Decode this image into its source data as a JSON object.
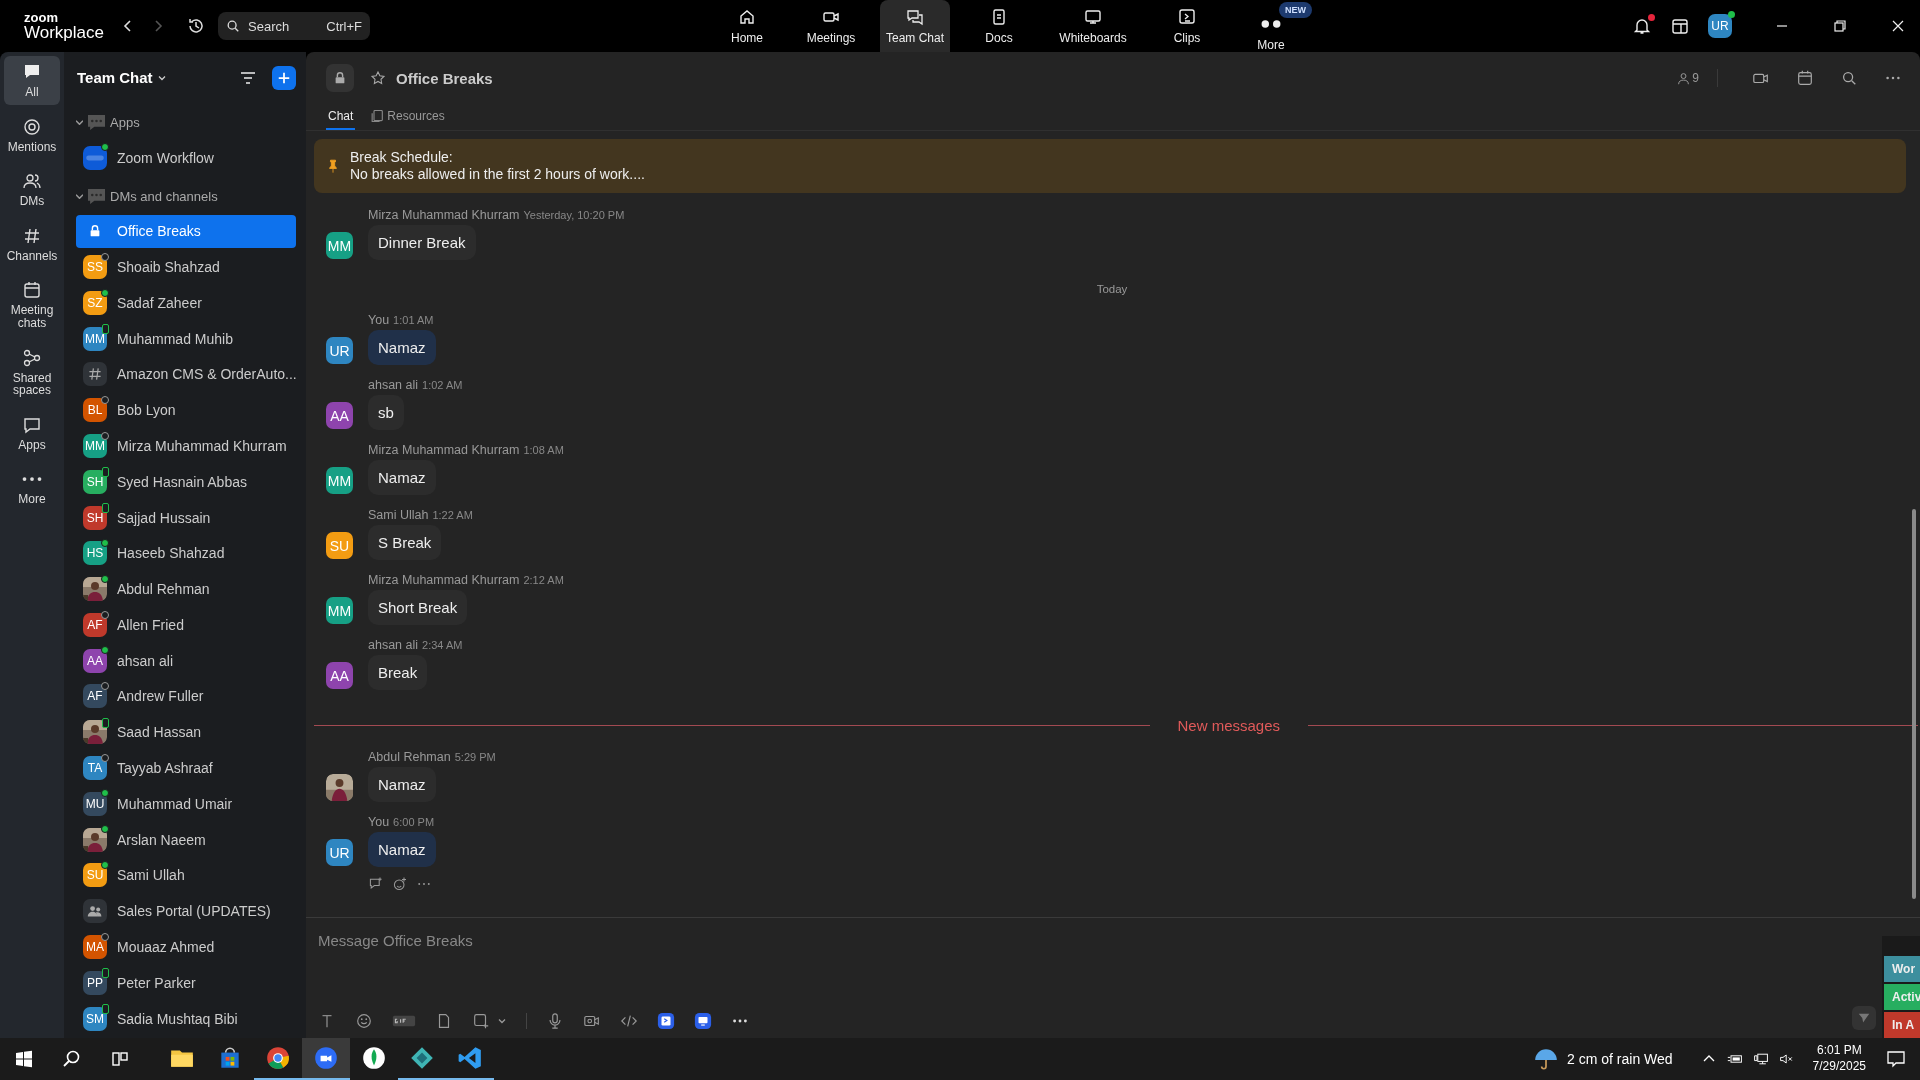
{
  "app": {
    "logo_top": "zoom",
    "logo_bottom": "Workplace"
  },
  "search": {
    "placeholder": "Search",
    "shortcut": "Ctrl+F"
  },
  "nav": [
    {
      "kind": "home",
      "label": "Home",
      "selected": false
    },
    {
      "kind": "meetings",
      "label": "Meetings",
      "selected": false
    },
    {
      "kind": "chat",
      "label": "Team Chat",
      "selected": true
    },
    {
      "kind": "docs",
      "label": "Docs",
      "selected": false
    },
    {
      "kind": "whiteboards",
      "label": "Whiteboards",
      "selected": false
    },
    {
      "kind": "clips",
      "label": "Clips",
      "selected": false
    },
    {
      "kind": "more",
      "label": "More",
      "selected": false,
      "badge": "NEW"
    }
  ],
  "account": {
    "initials": "UR",
    "notification_unread": true
  },
  "rail": [
    {
      "kind": "all",
      "label": "All",
      "selected": true
    },
    {
      "kind": "mentions",
      "label": "Mentions",
      "selected": false
    },
    {
      "kind": "dms",
      "label": "DMs",
      "selected": false
    },
    {
      "kind": "channels",
      "label": "Channels",
      "selected": false
    },
    {
      "kind": "meeting-chats",
      "label": "Meeting chats",
      "selected": false
    },
    {
      "kind": "shared",
      "label": "Shared spaces",
      "selected": false
    },
    {
      "kind": "apps",
      "label": "Apps",
      "selected": false
    },
    {
      "kind": "more",
      "label": "More",
      "selected": false
    }
  ],
  "sidebar": {
    "title": "Team Chat",
    "sections": [
      {
        "label": "Apps",
        "expanded": true,
        "items": [
          {
            "kind": "app",
            "name": "Zoom Workflow",
            "online": true,
            "mobile": false,
            "selected": false
          }
        ]
      },
      {
        "label": "DMs and channels",
        "expanded": true,
        "items": [
          {
            "kind": "channel",
            "name": "Office Breaks",
            "selected": true
          },
          {
            "kind": "dm",
            "name": "Shoaib Shahzad",
            "initials": "SS",
            "color": "#f39c12",
            "online": false,
            "mobile": false,
            "selected": false
          },
          {
            "kind": "dm",
            "name": "Sadaf Zaheer",
            "initials": "SZ",
            "color": "#f39c12",
            "online": true,
            "mobile": false,
            "selected": false
          },
          {
            "kind": "dm",
            "name": "Muhammad Muhib",
            "initials": "MM",
            "color": "#2e86c1",
            "online": true,
            "mobile": true,
            "selected": false
          },
          {
            "kind": "group-channel",
            "name": "Amazon CMS & OrderAuto...",
            "selected": false
          },
          {
            "kind": "dm",
            "name": "Bob Lyon",
            "initials": "BL",
            "color": "#d35400",
            "online": false,
            "mobile": false,
            "selected": false
          },
          {
            "kind": "dm",
            "name": "Mirza Muhammad Khurram",
            "initials": "MM",
            "color": "#16a085",
            "online": false,
            "mobile": false,
            "selected": false
          },
          {
            "kind": "dm",
            "name": "Syed Hasnain Abbas",
            "initials": "SH",
            "color": "#27ae60",
            "online": true,
            "mobile": true,
            "selected": false
          },
          {
            "kind": "dm",
            "name": "Sajjad Hussain",
            "initials": "SH",
            "color": "#c0392b",
            "online": true,
            "mobile": true,
            "selected": false
          },
          {
            "kind": "dm",
            "name": "Haseeb Shahzad",
            "initials": "HS",
            "color": "#16a085",
            "online": true,
            "mobile": false,
            "selected": false
          },
          {
            "name": "Abdul Rehman",
            "online": true,
            "mobile": false,
            "selected": false
          },
          {
            "kind": "dm",
            "name": "Allen Fried",
            "initials": "AF",
            "color": "#c0392b",
            "online": false,
            "mobile": false,
            "selected": false
          },
          {
            "kind": "dm",
            "name": "ahsan ali",
            "initials": "AA",
            "color": "#8e44ad",
            "online": true,
            "mobile": false,
            "selected": false
          },
          {
            "kind": "dm",
            "name": "Andrew Fuller",
            "initials": "AF",
            "color": "#34495e",
            "online": false,
            "mobile": false,
            "selected": false
          },
          {
            "name": "Saad Hassan",
            "online": true,
            "mobile": true,
            "selected": false
          },
          {
            "kind": "dm",
            "name": "Tayyab Ashraaf",
            "initials": "TA",
            "color": "#2e86c1",
            "online": false,
            "mobile": false,
            "selected": false
          },
          {
            "kind": "dm",
            "name": "Muhammad Umair",
            "initials": "MU",
            "color": "#34495e",
            "online": true,
            "mobile": false,
            "selected": false
          },
          {
            "name": "Arslan Naeem",
            "online": true,
            "mobile": false,
            "selected": false
          },
          {
            "kind": "dm",
            "name": "Sami Ullah",
            "initials": "SU",
            "color": "#f39c12",
            "online": true,
            "mobile": false,
            "selected": false
          },
          {
            "kind": "group",
            "name": "Sales Portal (UPDATES)",
            "selected": false
          },
          {
            "kind": "dm",
            "name": "Mouaaz Ahmed",
            "initials": "MA",
            "color": "#d35400",
            "online": false,
            "mobile": false,
            "selected": false
          },
          {
            "kind": "dm",
            "name": "Peter Parker",
            "initials": "PP",
            "color": "#34495e",
            "online": true,
            "mobile": true,
            "selected": false
          },
          {
            "kind": "dm",
            "name": "Sadia Mushtaq Bibi",
            "initials": "SM",
            "color": "#2e86c1",
            "online": true,
            "mobile": true,
            "selected": false
          }
        ]
      }
    ]
  },
  "chat": {
    "title": "Office Breaks",
    "starred": false,
    "member_count": "9",
    "tabs": [
      {
        "label": "Chat",
        "selected": true
      },
      {
        "label": "Resources",
        "selected": false
      }
    ],
    "pinned": {
      "title": "Break Schedule:",
      "text": "No breaks allowed in the first 2 hours of work...."
    },
    "timeline": [
      {
        "kind": "message",
        "sender": "Mirza Muhammad Khurram",
        "time": "Yesterday, 10:20 PM",
        "initials": "MM",
        "color": "#16a085",
        "text": "Dinner Break",
        "mine": false
      },
      {
        "kind": "date-divider",
        "label": "Today"
      },
      {
        "kind": "message",
        "sender": "You",
        "time": "1:01 AM",
        "initials": "UR",
        "color": "#2e86c1",
        "text": "Namaz",
        "mine": true
      },
      {
        "kind": "message",
        "sender": "ahsan ali",
        "time": "1:02 AM",
        "initials": "AA",
        "color": "#8e44ad",
        "text": "sb",
        "mine": false
      },
      {
        "kind": "message",
        "sender": "Mirza Muhammad Khurram",
        "time": "1:08 AM",
        "initials": "MM",
        "color": "#16a085",
        "text": "Namaz",
        "mine": false
      },
      {
        "kind": "message",
        "sender": "Sami Ullah",
        "time": "1:22 AM",
        "initials": "SU",
        "color": "#f39c12",
        "text": "S Break",
        "mine": false
      },
      {
        "kind": "message",
        "sender": "Mirza Muhammad Khurram",
        "time": "2:12 AM",
        "initials": "MM",
        "color": "#16a085",
        "text": "Short Break",
        "mine": false
      },
      {
        "kind": "message",
        "sender": "ahsan ali",
        "time": "2:34 AM",
        "initials": "AA",
        "color": "#8e44ad",
        "text": "Break",
        "mine": false
      },
      {
        "kind": "new-divider",
        "label": "New messages"
      },
      {
        "kind": "message",
        "sender": "Abdul Rehman",
        "time": "5:29 PM",
        "photo": true,
        "text": "Namaz",
        "mine": false
      },
      {
        "kind": "message",
        "sender": "You",
        "time": "6:00 PM",
        "initials": "UR",
        "color": "#2e86c1",
        "text": "Namaz",
        "mine": true,
        "show_actions": true
      }
    ],
    "composer": {
      "placeholder": "Message Office Breaks"
    }
  },
  "overlay": [
    {
      "label": "Wor",
      "color": "#3d8f9e"
    },
    {
      "label": "Activ",
      "color": "#27ae60"
    },
    {
      "label": "In A",
      "color": "#c0392b"
    }
  ],
  "taskbar": {
    "apps": [
      {
        "kind": "files",
        "running": false,
        "active": false
      },
      {
        "kind": "store",
        "running": false,
        "active": false
      },
      {
        "kind": "chrome",
        "running": true,
        "active": false
      },
      {
        "kind": "zoom",
        "running": true,
        "active": true
      },
      {
        "kind": "mongo",
        "running": false,
        "active": false
      },
      {
        "kind": "gem",
        "running": true,
        "active": false
      },
      {
        "kind": "vscode",
        "running": true,
        "active": false
      }
    ],
    "weather": "2 cm of rain Wed",
    "time": "6:01 PM",
    "date": "7/29/2025"
  }
}
